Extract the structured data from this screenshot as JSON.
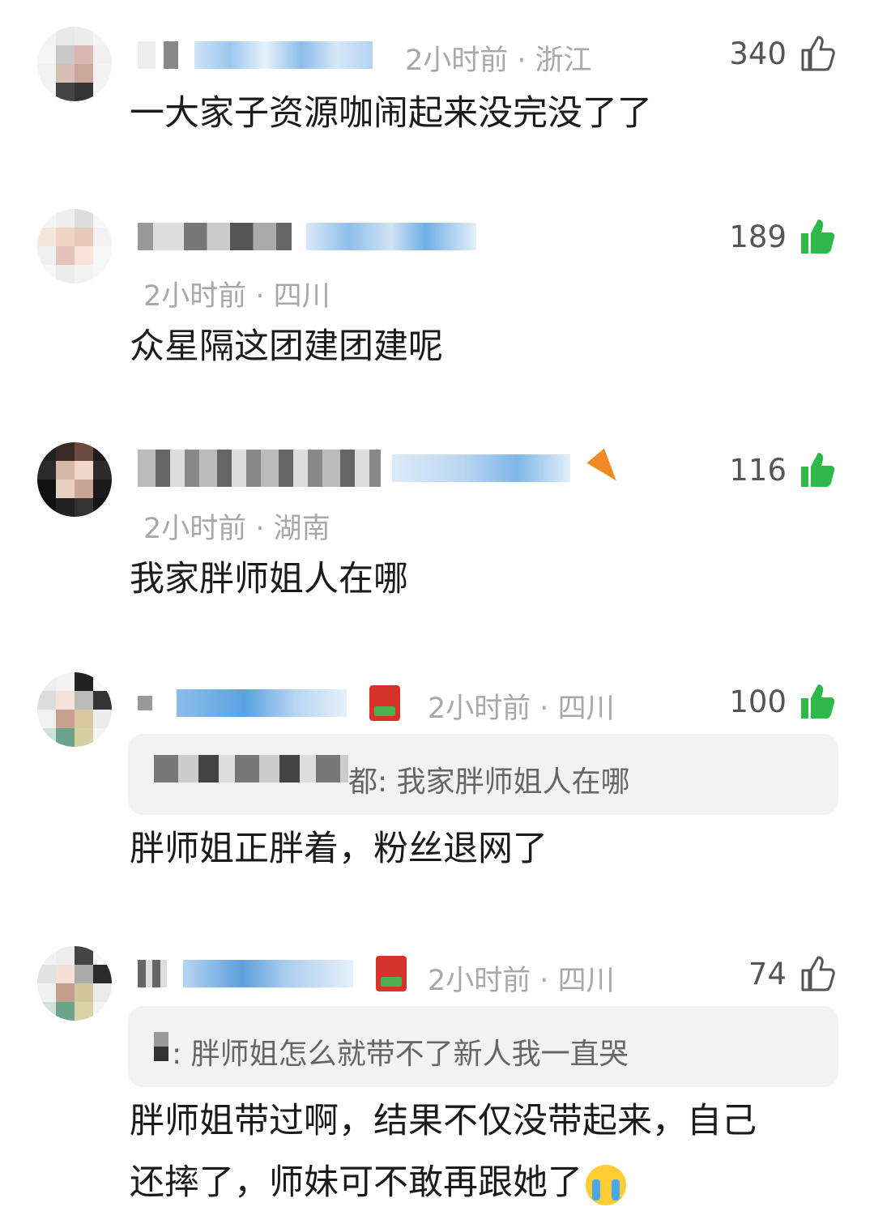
{
  "comments": [
    {
      "time_location": "2小时前 · 浙江",
      "likes": "340",
      "liked": false,
      "text": "一大家子资源咖闹起来没完没了了"
    },
    {
      "time_location": "2小时前 · 四川",
      "likes": "189",
      "liked": true,
      "text": "众星隔这团建团建呢"
    },
    {
      "time_location": "2小时前 · 湖南",
      "likes": "116",
      "liked": true,
      "text": "我家胖师姐人在哪"
    },
    {
      "time_location": "2小时前 · 四川",
      "likes": "100",
      "liked": true,
      "reply_quote": "都: 我家胖师姐人在哪",
      "text": "胖师姐正胖着，粉丝退网了"
    },
    {
      "time_location": "2小时前 · 四川",
      "likes": "74",
      "liked": false,
      "reply_quote": ": 胖师姐怎么就带不了新人我一直哭",
      "text_line1": "胖师姐带过啊，结果不仅没带起来，自己",
      "text_line2": "还摔了，师妹可不敢再跟她了"
    }
  ],
  "colors": {
    "like_green": "#2fb84a",
    "like_outline": "#555555",
    "meta_gray": "#a8a8a8",
    "reply_bg": "#f2f2f2"
  },
  "icons": [
    "thumbs-up-outline-icon",
    "thumbs-up-filled-icon",
    "carrot-badge-icon",
    "book-badge-icon",
    "crying-emoji-icon"
  ]
}
